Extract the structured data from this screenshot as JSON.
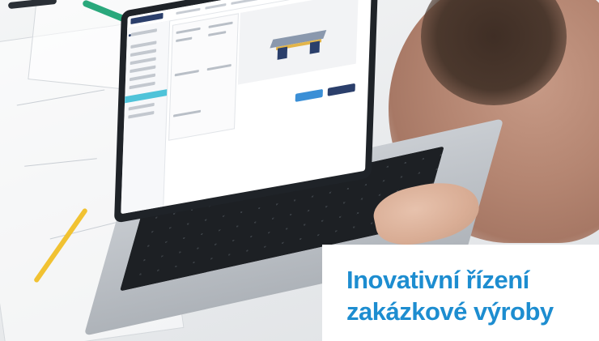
{
  "promo": {
    "title": "Inovativní řízení zakázkové výroby",
    "title_color": "#1d8dd0"
  },
  "scene": {
    "description_tag": "laptop-on-desk-with-engineering-app",
    "accent_colors": {
      "app_navy": "#2b3f6b",
      "app_cyan": "#4fc3d9",
      "pencil_yellow": "#f1c232"
    }
  }
}
